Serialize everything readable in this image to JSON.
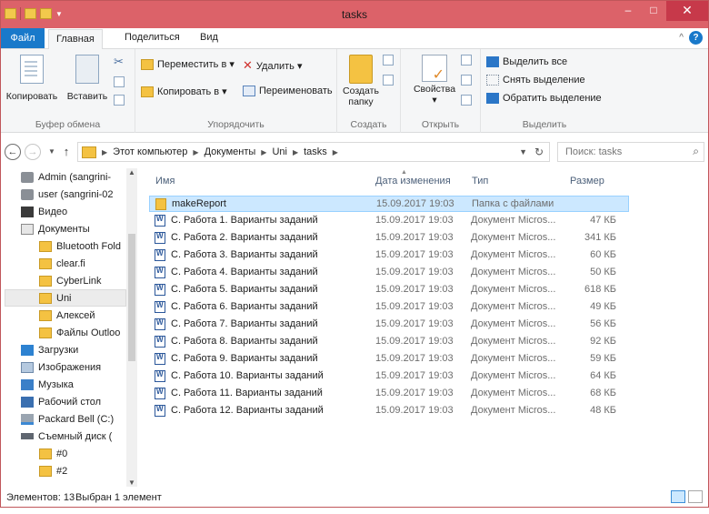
{
  "window": {
    "title": "tasks",
    "minimize": "–",
    "maximize": "□",
    "close": "✕"
  },
  "tabs": {
    "file": "Файл",
    "home": "Главная",
    "share": "Поделиться",
    "view": "Вид",
    "help": "?",
    "collapse": "^"
  },
  "ribbon": {
    "clipboard": {
      "copy": "Копировать",
      "paste": "Вставить",
      "label": "Буфер обмена"
    },
    "organize": {
      "move_to": "Переместить в ▾",
      "copy_to": "Копировать в ▾",
      "delete": "Удалить ▾",
      "rename": "Переименовать",
      "label": "Упорядочить"
    },
    "new": {
      "create_folder_line1": "Создать",
      "create_folder_line2": "папку",
      "label": "Создать"
    },
    "open": {
      "properties": "Свойства",
      "properties_arrow": "▾",
      "label": "Открыть"
    },
    "select": {
      "select_all": "Выделить все",
      "select_none": "Снять выделение",
      "invert": "Обратить выделение",
      "label": "Выделить"
    }
  },
  "address": {
    "crumbs": [
      "Этот компьютер",
      "Документы",
      "Uni",
      "tasks"
    ],
    "search_placeholder": "Поиск: tasks"
  },
  "nav": {
    "items": [
      {
        "label": "Admin (sangrini-",
        "icon": "network-user-icon"
      },
      {
        "label": "user (sangrini-02",
        "icon": "network-user-icon"
      },
      {
        "label": "Видео",
        "icon": "video-folder-icon"
      },
      {
        "label": "Документы",
        "icon": "documents-folder-icon"
      },
      {
        "label": "Bluetooth Fold",
        "icon": "folder-icon"
      },
      {
        "label": "clear.fi",
        "icon": "folder-icon"
      },
      {
        "label": "CyberLink",
        "icon": "folder-icon"
      },
      {
        "label": "Uni",
        "icon": "folder-icon"
      },
      {
        "label": "Алексей",
        "icon": "folder-icon"
      },
      {
        "label": "Файлы Outloo",
        "icon": "folder-icon"
      },
      {
        "label": "Загрузки",
        "icon": "downloads-folder-icon"
      },
      {
        "label": "Изображения",
        "icon": "pictures-folder-icon"
      },
      {
        "label": "Музыка",
        "icon": "music-folder-icon"
      },
      {
        "label": "Рабочий стол",
        "icon": "desktop-folder-icon"
      },
      {
        "label": "Packard Bell (C:)",
        "icon": "drive-icon"
      },
      {
        "label": "Съемный диск (",
        "icon": "removable-drive-icon"
      },
      {
        "label": "#0",
        "icon": "folder-icon"
      },
      {
        "label": "#2",
        "icon": "folder-icon"
      }
    ]
  },
  "columns": {
    "name": "Имя",
    "date": "Дата изменения",
    "type": "Тип",
    "size": "Размер"
  },
  "files": [
    {
      "name": "makeReport",
      "date": "15.09.2017 19:03",
      "type": "Папка с файлами",
      "size": "",
      "icon": "folder-icon"
    },
    {
      "name": "С. Работа 1. Варианты заданий",
      "date": "15.09.2017 19:03",
      "type": "Документ Micros...",
      "size": "47 КБ",
      "icon": "word-document-icon"
    },
    {
      "name": "С. Работа 2. Варианты заданий",
      "date": "15.09.2017 19:03",
      "type": "Документ Micros...",
      "size": "341 КБ",
      "icon": "word-document-icon"
    },
    {
      "name": "С. Работа 3. Варианты заданий",
      "date": "15.09.2017 19:03",
      "type": "Документ Micros...",
      "size": "60 КБ",
      "icon": "word-document-icon"
    },
    {
      "name": "С. Работа 4. Варианты заданий",
      "date": "15.09.2017 19:03",
      "type": "Документ Micros...",
      "size": "50 КБ",
      "icon": "word-document-icon"
    },
    {
      "name": "С. Работа 5. Варианты заданий",
      "date": "15.09.2017 19:03",
      "type": "Документ Micros...",
      "size": "618 КБ",
      "icon": "word-document-icon"
    },
    {
      "name": "С. Работа 6. Варианты заданий",
      "date": "15.09.2017 19:03",
      "type": "Документ Micros...",
      "size": "49 КБ",
      "icon": "word-document-icon"
    },
    {
      "name": "С. Работа 7. Варианты заданий",
      "date": "15.09.2017 19:03",
      "type": "Документ Micros...",
      "size": "56 КБ",
      "icon": "word-document-icon"
    },
    {
      "name": "С. Работа 8. Варианты заданий",
      "date": "15.09.2017 19:03",
      "type": "Документ Micros...",
      "size": "92 КБ",
      "icon": "word-document-icon"
    },
    {
      "name": "С. Работа 9. Варианты заданий",
      "date": "15.09.2017 19:03",
      "type": "Документ Micros...",
      "size": "59 КБ",
      "icon": "word-document-icon"
    },
    {
      "name": "С. Работа 10. Варианты заданий",
      "date": "15.09.2017 19:03",
      "type": "Документ Micros...",
      "size": "64 КБ",
      "icon": "word-document-icon"
    },
    {
      "name": "С. Работа 11. Варианты заданий",
      "date": "15.09.2017 19:03",
      "type": "Документ Micros...",
      "size": "68 КБ",
      "icon": "word-document-icon"
    },
    {
      "name": "С. Работа 12. Варианты заданий",
      "date": "15.09.2017 19:03",
      "type": "Документ Micros...",
      "size": "48 КБ",
      "icon": "word-document-icon"
    }
  ],
  "status": {
    "count": "Элементов: 13",
    "selection": "Выбран 1 элемент"
  },
  "colors": {
    "titlebar": "#dc6269",
    "file_tab": "#1979ca",
    "selection": "#cce8ff"
  }
}
